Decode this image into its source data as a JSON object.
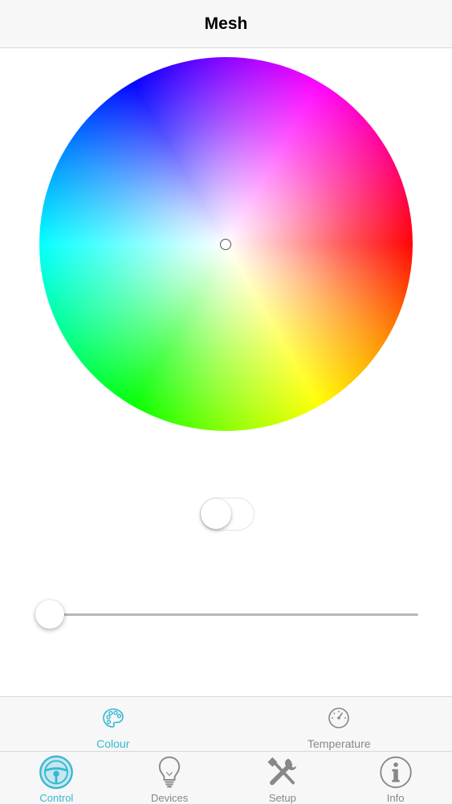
{
  "navbar": {
    "title": "Mesh"
  },
  "colour_wheel": {
    "selected_hue": "white"
  },
  "power_toggle": {
    "on": false
  },
  "brightness_slider": {
    "value": 0
  },
  "segments": [
    {
      "label": "Colour",
      "icon": "palette-icon",
      "active": true
    },
    {
      "label": "Temperature",
      "icon": "gauge-icon",
      "active": false
    }
  ],
  "tabs": [
    {
      "label": "Control",
      "icon": "steering-wheel-icon",
      "active": true
    },
    {
      "label": "Devices",
      "icon": "light-bulb-icon",
      "active": false
    },
    {
      "label": "Setup",
      "icon": "tools-icon",
      "active": false
    },
    {
      "label": "Info",
      "icon": "info-icon",
      "active": false
    }
  ],
  "colors": {
    "accent": "#35b8d3",
    "inactive": "#888888",
    "bar_bg": "#f7f7f7"
  }
}
